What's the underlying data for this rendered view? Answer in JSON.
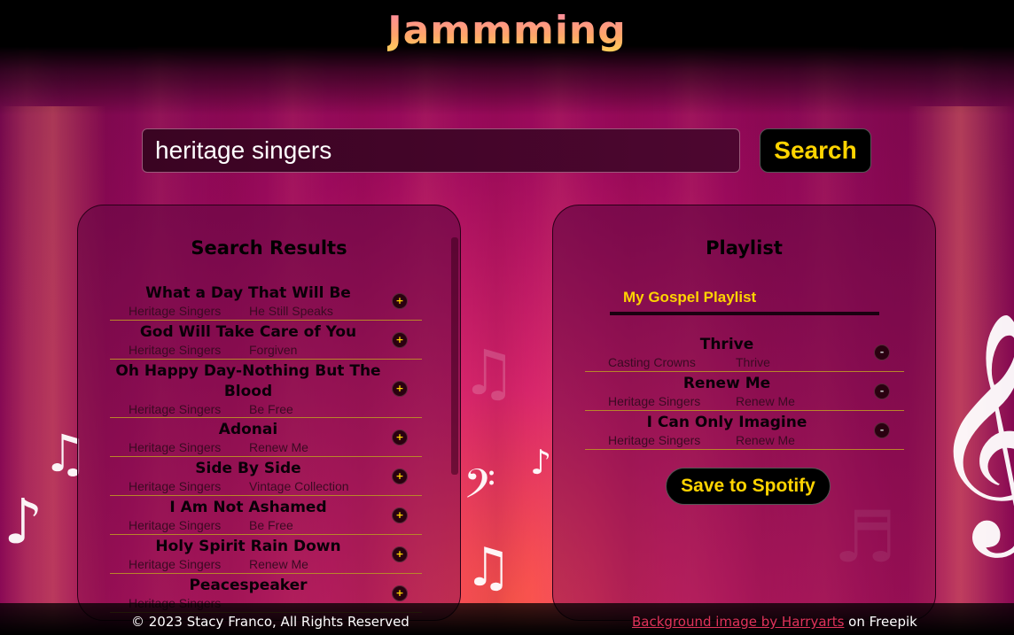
{
  "app": {
    "title": "Jammming"
  },
  "search": {
    "value": "heritage singers",
    "button_label": "Search"
  },
  "results": {
    "title": "Search Results",
    "add_symbol": "+",
    "tracks": [
      {
        "name": "What a Day That Will Be",
        "artist": "Heritage Singers",
        "album": "He Still Speaks"
      },
      {
        "name": "God Will Take Care of You",
        "artist": "Heritage Singers",
        "album": "Forgiven"
      },
      {
        "name": "Oh Happy Day-Nothing But The Blood",
        "artist": "Heritage Singers",
        "album": "Be Free"
      },
      {
        "name": "Adonai",
        "artist": "Heritage Singers",
        "album": "Renew Me"
      },
      {
        "name": "Side By Side",
        "artist": "Heritage Singers",
        "album": "Vintage Collection"
      },
      {
        "name": "I Am Not Ashamed",
        "artist": "Heritage Singers",
        "album": "Be Free"
      },
      {
        "name": "Holy Spirit Rain Down",
        "artist": "Heritage Singers",
        "album": "Renew Me"
      },
      {
        "name": "Peacespeaker",
        "artist": "Heritage Singers",
        "album": ""
      }
    ]
  },
  "playlist": {
    "title": "Playlist",
    "name_value": "My Gospel Playlist",
    "remove_symbol": "-",
    "save_label": "Save to Spotify",
    "tracks": [
      {
        "name": "Thrive",
        "artist": "Casting Crowns",
        "album": "Thrive"
      },
      {
        "name": "Renew Me",
        "artist": "Heritage Singers",
        "album": "Renew Me"
      },
      {
        "name": "I Can Only Imagine",
        "artist": "Heritage Singers",
        "album": "Renew Me"
      }
    ]
  },
  "footer": {
    "copyright": "© 2023 Stacy Franco, All Rights Reserved",
    "credit_link": "Background image by Harryarts",
    "credit_suffix": " on Freepik"
  },
  "colors": {
    "accent": "#ffd400",
    "title_gradient_start": "#ff86a8",
    "title_gradient_end": "#ffd35a",
    "background": "#9c0a5c"
  }
}
